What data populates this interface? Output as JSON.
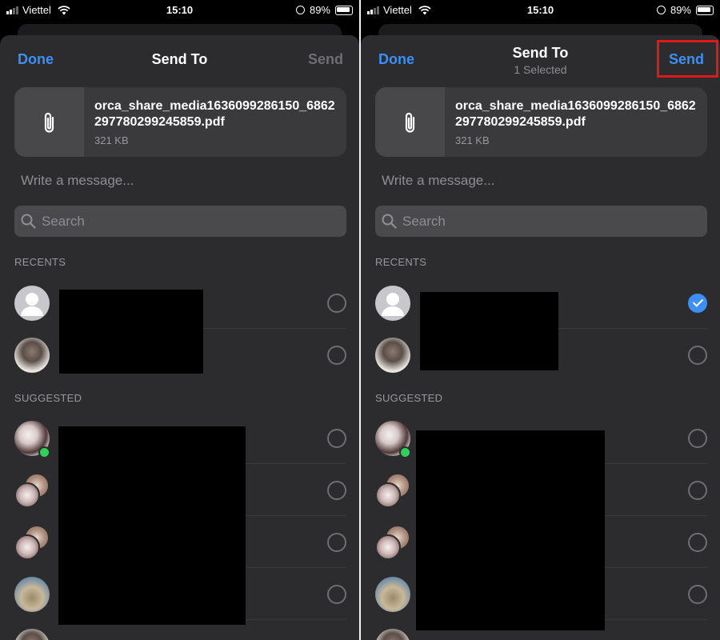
{
  "status_bar": {
    "carrier": "Viettel",
    "time": "15:10",
    "battery": "89%"
  },
  "screens": [
    {
      "header": {
        "done": "Done",
        "title": "Send To",
        "subtitle": "",
        "send": "Send",
        "send_enabled": false
      },
      "file": {
        "name": "orca_share_media1636099286150_6862297780299245859.pdf",
        "size": "321 KB"
      },
      "message_placeholder": "Write a message...",
      "search_placeholder": "Search",
      "recents_label": "RECENTS",
      "suggested_label": "SUGGESTED",
      "recents": [
        {
          "avatar": "default-avatar",
          "selected": false
        },
        {
          "avatar": "photo-avatar",
          "selected": false
        }
      ],
      "suggested": [
        {
          "avatar": "photo-avatar",
          "online": true,
          "selected": false
        },
        {
          "avatar": "group-avatar",
          "selected": false
        },
        {
          "avatar": "group-avatar",
          "selected": false
        },
        {
          "avatar": "photo-avatar",
          "selected": false
        }
      ]
    },
    {
      "header": {
        "done": "Done",
        "title": "Send To",
        "subtitle": "1 Selected",
        "send": "Send",
        "send_enabled": true
      },
      "file": {
        "name": "orca_share_media1636099286150_6862297780299245859.pdf",
        "size": "321 KB"
      },
      "message_placeholder": "Write a message...",
      "search_placeholder": "Search",
      "recents_label": "RECENTS",
      "suggested_label": "SUGGESTED",
      "recents": [
        {
          "avatar": "default-avatar",
          "selected": true
        },
        {
          "avatar": "photo-avatar",
          "selected": false
        }
      ],
      "suggested": [
        {
          "avatar": "photo-avatar",
          "online": true,
          "selected": false
        },
        {
          "avatar": "group-avatar",
          "selected": false
        },
        {
          "avatar": "group-avatar",
          "selected": false
        },
        {
          "avatar": "photo-avatar",
          "selected": false
        }
      ]
    }
  ],
  "colors": {
    "accent": "#3d8ff5",
    "sheet": "#2c2c2e",
    "highlight": "#e01818",
    "online": "#30d158"
  }
}
